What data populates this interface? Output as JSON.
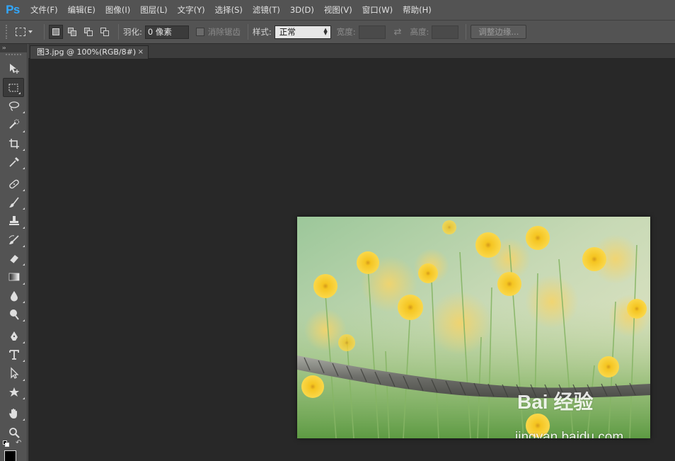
{
  "app": {
    "logo": "Ps",
    "brand_color": "#31a8ff"
  },
  "menu": [
    "文件(F)",
    "编辑(E)",
    "图像(I)",
    "图层(L)",
    "文字(Y)",
    "选择(S)",
    "滤镜(T)",
    "3D(D)",
    "视图(V)",
    "窗口(W)",
    "帮助(H)"
  ],
  "options": {
    "feather_label": "羽化:",
    "feather_value": "0 像素",
    "antialias_label": "消除锯齿",
    "style_label": "样式:",
    "style_value": "正常",
    "width_label": "宽度:",
    "height_label": "高度:",
    "refine_edge_label": "调整边缘..."
  },
  "document": {
    "tab_title": "图3.jpg @ 100%(RGB/8#)",
    "close_glyph": "×"
  },
  "image": {
    "watermark_logo": "Bai  经验",
    "watermark_url": "jingyan.baidu.com"
  },
  "toolbox": {
    "collapse_glyph": "››",
    "tools": [
      "move-tool",
      "rectangular-marquee-tool",
      "lasso-tool",
      "quick-selection-tool",
      "crop-tool",
      "eyedropper-tool",
      "spot-healing-brush-tool",
      "brush-tool",
      "clone-stamp-tool",
      "history-brush-tool",
      "eraser-tool",
      "gradient-tool",
      "blur-tool",
      "dodge-tool",
      "pen-tool",
      "type-tool",
      "path-selection-tool",
      "custom-shape-tool",
      "hand-tool",
      "zoom-tool"
    ],
    "selected_tool": "rectangular-marquee-tool",
    "foreground_color": "#000000",
    "background_color": "#ffffff"
  },
  "colors": {
    "window_bg": "#535353",
    "canvas_bg": "#282828",
    "tabbar_bg": "#3c3c3c"
  }
}
